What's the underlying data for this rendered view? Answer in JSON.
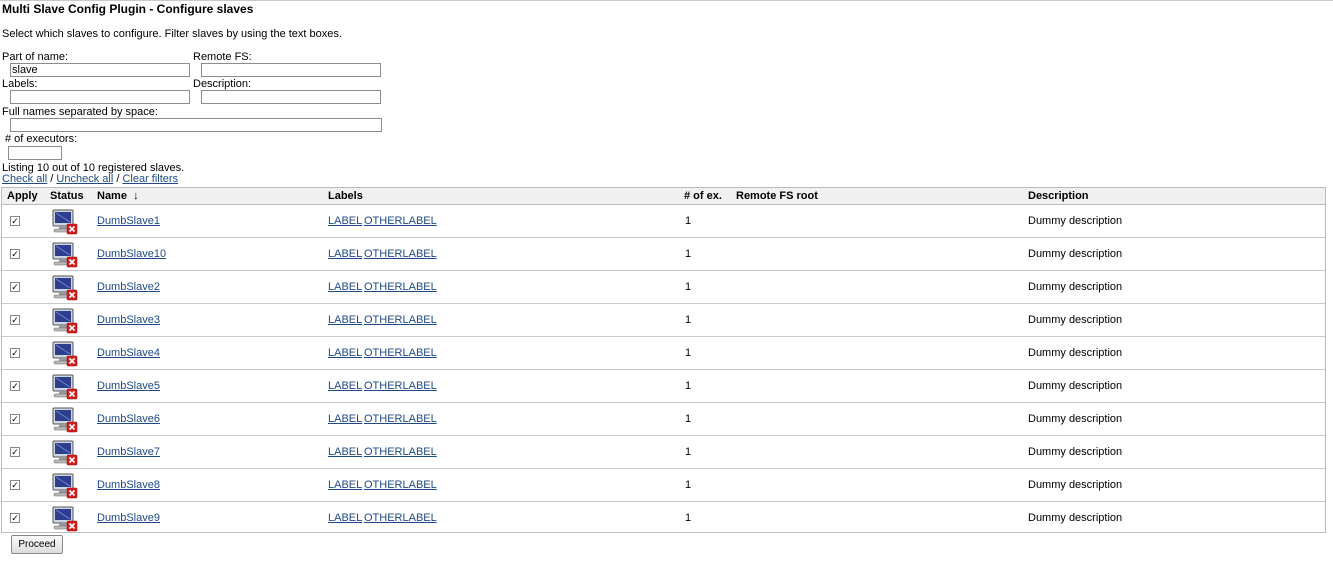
{
  "title": "Multi Slave Config Plugin - Configure slaves",
  "intro": "Select which slaves to configure. Filter slaves by using the text boxes.",
  "filters": {
    "part_of_name": {
      "label": "Part of name:",
      "value": "slave"
    },
    "remote_fs": {
      "label": "Remote FS:",
      "value": ""
    },
    "labels": {
      "label": "Labels:",
      "value": ""
    },
    "description": {
      "label": "Description:",
      "value": ""
    },
    "full_names": {
      "label": "Full names separated by space:",
      "value": ""
    },
    "executors": {
      "label": "# of executors:",
      "value": ""
    }
  },
  "listing": "Listing 10 out of 10 registered slaves.",
  "links": {
    "check_all": "Check all",
    "sep": " / ",
    "uncheck_all": "Uncheck all",
    "clear_filters": "Clear filters"
  },
  "table": {
    "headers": {
      "apply": "Apply",
      "status": "Status",
      "name": "Name",
      "sort": "↓",
      "labels": "Labels",
      "executors": "# of ex.",
      "remote_fs": "Remote FS root",
      "description": "Description"
    },
    "rows": [
      {
        "name": "DumbSlave1",
        "label1": "LABEL",
        "label2": "OTHERLABEL",
        "executors": "1",
        "remote_fs": "",
        "description": "Dummy description"
      },
      {
        "name": "DumbSlave10",
        "label1": "LABEL",
        "label2": "OTHERLABEL",
        "executors": "1",
        "remote_fs": "",
        "description": "Dummy description"
      },
      {
        "name": "DumbSlave2",
        "label1": "LABEL",
        "label2": "OTHERLABEL",
        "executors": "1",
        "remote_fs": "",
        "description": "Dummy description"
      },
      {
        "name": "DumbSlave3",
        "label1": "LABEL",
        "label2": "OTHERLABEL",
        "executors": "1",
        "remote_fs": "",
        "description": "Dummy description"
      },
      {
        "name": "DumbSlave4",
        "label1": "LABEL",
        "label2": "OTHERLABEL",
        "executors": "1",
        "remote_fs": "",
        "description": "Dummy description"
      },
      {
        "name": "DumbSlave5",
        "label1": "LABEL",
        "label2": "OTHERLABEL",
        "executors": "1",
        "remote_fs": "",
        "description": "Dummy description"
      },
      {
        "name": "DumbSlave6",
        "label1": "LABEL",
        "label2": "OTHERLABEL",
        "executors": "1",
        "remote_fs": "",
        "description": "Dummy description"
      },
      {
        "name": "DumbSlave7",
        "label1": "LABEL",
        "label2": "OTHERLABEL",
        "executors": "1",
        "remote_fs": "",
        "description": "Dummy description"
      },
      {
        "name": "DumbSlave8",
        "label1": "LABEL",
        "label2": "OTHERLABEL",
        "executors": "1",
        "remote_fs": "",
        "description": "Dummy description"
      },
      {
        "name": "DumbSlave9",
        "label1": "LABEL",
        "label2": "OTHERLABEL",
        "executors": "1",
        "remote_fs": "",
        "description": "Dummy description"
      }
    ]
  },
  "status_icon": "offline-computer-icon",
  "colors": {
    "link": "#204a87",
    "offline_badge": "#d21f1f"
  },
  "proceed_label": "Proceed"
}
